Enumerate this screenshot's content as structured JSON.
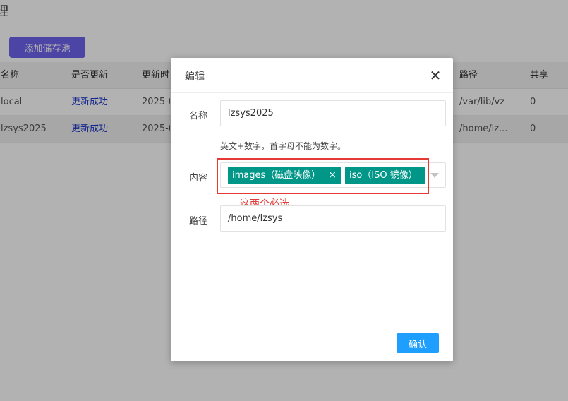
{
  "page": {
    "title_fragment": "理",
    "add_pool_label": "添加储存池"
  },
  "table": {
    "headers": {
      "name": "名称",
      "update": "是否更新",
      "time": "更新时",
      "path": "路径",
      "share": "共享"
    },
    "rows": [
      {
        "name": "local",
        "update": "更新成功",
        "time": "2025-0",
        "path": "/var/lib/vz",
        "share": "0"
      },
      {
        "name": "lzsys2025",
        "update": "更新成功",
        "time": "2025-0",
        "path": "/home/lz...",
        "share": "0"
      }
    ]
  },
  "modal": {
    "title": "编辑",
    "close_symbol": "✕",
    "name_label": "名称",
    "name_value": "lzsys2025",
    "name_hint": "英文+数字，首字母不能为数字。",
    "content_label": "内容",
    "tags": [
      {
        "label": "images（磁盘映像）",
        "remove_symbol": "×"
      },
      {
        "label": "iso（ISO 镜像）"
      }
    ],
    "annotation": "这两个必选",
    "path_label": "路径",
    "path_value": "/home/lzsys",
    "confirm_label": "确认"
  },
  "colors": {
    "primary_button": "#6f63ec",
    "tag": "#009688",
    "confirm": "#1e9fff",
    "link": "#1a35c9",
    "annotation": "#e53935"
  }
}
